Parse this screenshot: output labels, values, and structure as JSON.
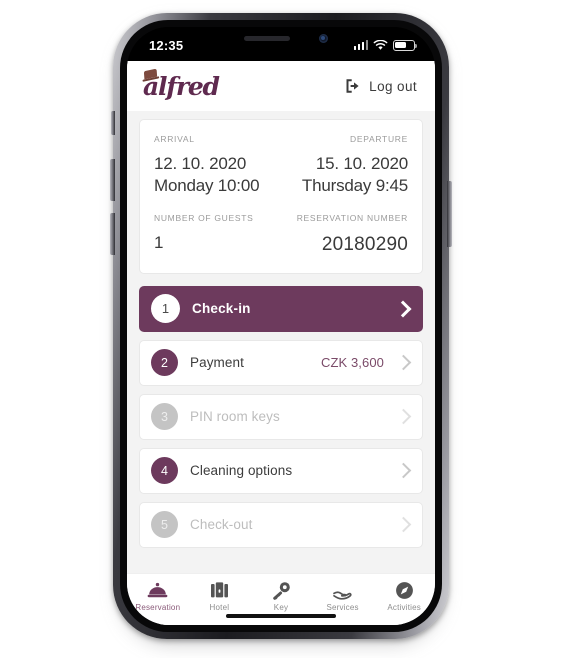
{
  "status_bar": {
    "time": "12:35",
    "signal_icon": "signal-bars-icon",
    "wifi_icon": "wifi-icon",
    "battery_icon": "battery-icon"
  },
  "header": {
    "logo_text": "alfred",
    "logo_icon": "hat-icon",
    "logout_label": "Log out",
    "logout_icon": "sign-out-icon"
  },
  "reservation": {
    "arrival_label": "ARRIVAL",
    "arrival_date": "12. 10. 2020",
    "arrival_time": "Monday 10:00",
    "departure_label": "DEPARTURE",
    "departure_date": "15. 10. 2020",
    "departure_time": "Thursday 9:45",
    "guests_label": "NUMBER OF GUESTS",
    "guests_value": "1",
    "number_label": "RESERVATION NUMBER",
    "number_value": "20180290"
  },
  "steps": [
    {
      "num": "1",
      "label": "Check-in",
      "amount": "",
      "state": "active"
    },
    {
      "num": "2",
      "label": "Payment",
      "amount": "CZK 3,600",
      "state": "enabled"
    },
    {
      "num": "3",
      "label": "PIN room keys",
      "amount": "",
      "state": "disabled"
    },
    {
      "num": "4",
      "label": "Cleaning options",
      "amount": "",
      "state": "enabled"
    },
    {
      "num": "5",
      "label": "Check-out",
      "amount": "",
      "state": "disabled"
    }
  ],
  "tabs": [
    {
      "label": "Reservation",
      "icon": "service-bell-icon",
      "active": true
    },
    {
      "label": "Hotel",
      "icon": "building-icon",
      "active": false
    },
    {
      "label": "Key",
      "icon": "key-icon",
      "active": false
    },
    {
      "label": "Services",
      "icon": "hand-heart-icon",
      "active": false
    },
    {
      "label": "Activities",
      "icon": "compass-icon",
      "active": false
    }
  ],
  "colors": {
    "brand_purple": "#6d3a5d",
    "accent_purple": "#7a4a68",
    "page_bg": "#f3f3f3",
    "disabled_gray": "#c4c4c4"
  }
}
